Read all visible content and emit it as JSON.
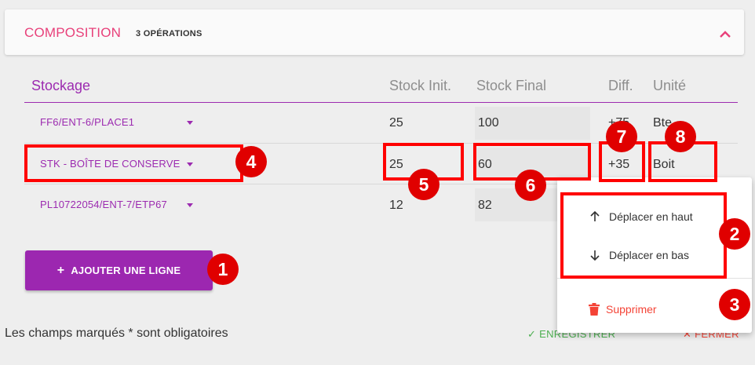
{
  "panel": {
    "title": "COMPOSITION",
    "subtitle": "3 OPÉRATIONS"
  },
  "table": {
    "headers": {
      "storage": "Stockage",
      "stock_init": "Stock Init.",
      "stock_final": "Stock Final",
      "diff": "Diff.",
      "unit": "Unité"
    },
    "rows": [
      {
        "storage": "FF6/ENT-6/PLACE1",
        "stock_init": "25",
        "stock_final": "100",
        "diff": "+75",
        "unit": "Bte"
      },
      {
        "storage": "STK - BOÎTE DE CONSERVE",
        "stock_init": "25",
        "stock_final": "60",
        "diff": "+35",
        "unit": "Boit"
      },
      {
        "storage": "PL10722054/ENT-7/ETP67",
        "stock_init": "12",
        "stock_final": "82",
        "diff": "",
        "unit": ""
      }
    ]
  },
  "add_button": {
    "label": "AJOUTER UNE LIGNE"
  },
  "footer": {
    "required_note": "Les champs marqués * sont obligatoires",
    "save_label": "ENREGISTRER",
    "close_label": "FERMER"
  },
  "context_menu": {
    "move_up": "Déplacer en haut",
    "move_down": "Déplacer en bas",
    "delete": "Supprimer"
  },
  "annotations": [
    "1",
    "2",
    "3",
    "4",
    "5",
    "6",
    "7",
    "8"
  ],
  "colors": {
    "accent_purple": "#9c27b0",
    "header_pink": "#e8407a",
    "danger": "#f44336",
    "success": "#4caf50",
    "annotation_red": "#ff0000"
  }
}
